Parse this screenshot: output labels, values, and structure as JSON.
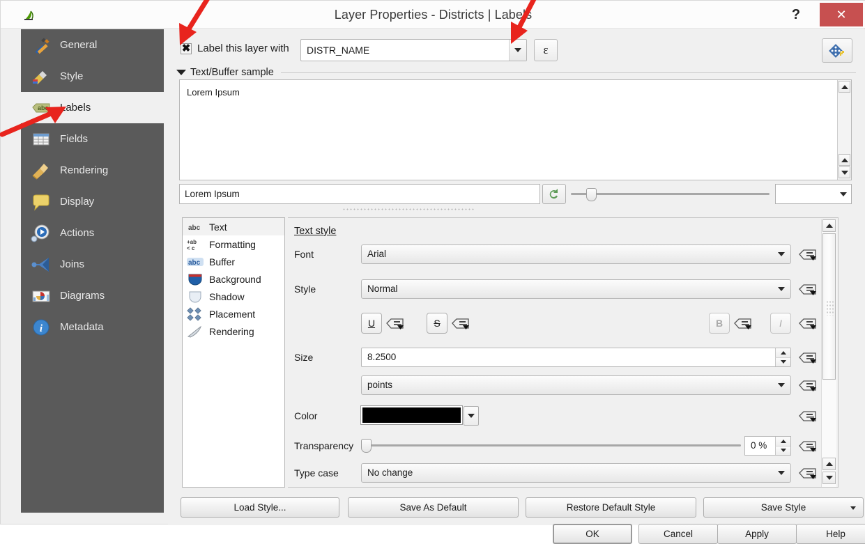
{
  "window": {
    "title": "Layer Properties - Districts | Labels",
    "app_icon": "qgis-icon",
    "help_label": "?",
    "close_label": "✕"
  },
  "sidebar": {
    "items": [
      {
        "label": "General",
        "icon": "tools-icon",
        "selected": false
      },
      {
        "label": "Style",
        "icon": "brush-icon",
        "selected": false
      },
      {
        "label": "Labels",
        "icon": "abc-label-icon",
        "selected": true
      },
      {
        "label": "Fields",
        "icon": "table-icon",
        "selected": false
      },
      {
        "label": "Rendering",
        "icon": "broom-icon",
        "selected": false
      },
      {
        "label": "Display",
        "icon": "callout-icon",
        "selected": false
      },
      {
        "label": "Actions",
        "icon": "gear-play-icon",
        "selected": false
      },
      {
        "label": "Joins",
        "icon": "join-icon",
        "selected": false
      },
      {
        "label": "Diagrams",
        "icon": "chart-icon",
        "selected": false
      },
      {
        "label": "Metadata",
        "icon": "info-icon",
        "selected": false
      }
    ]
  },
  "label_row": {
    "checkbox_glyph": "✖",
    "checkbox_checked": true,
    "label": "Label this layer with",
    "field_value": "DISTR_NAME",
    "expression_button": "ε",
    "auto_placement_icon": "auto-placement-icon"
  },
  "sample_group": {
    "title": "Text/Buffer sample",
    "collapsed": false,
    "preview_text": "Lorem Ipsum",
    "input_value": "Lorem Ipsum",
    "revert_icon": "revert-arrow-icon",
    "zoom_value": ""
  },
  "subtabs": {
    "items": [
      {
        "label": "Text",
        "icon": "abc-text-icon",
        "selected": true
      },
      {
        "label": "Formatting",
        "icon": "formatting-icon",
        "selected": false
      },
      {
        "label": "Buffer",
        "icon": "abc-buffer-icon",
        "selected": false
      },
      {
        "label": "Background",
        "icon": "background-icon",
        "selected": false
      },
      {
        "label": "Shadow",
        "icon": "shadow-icon",
        "selected": false
      },
      {
        "label": "Placement",
        "icon": "placement-icon",
        "selected": false
      },
      {
        "label": "Rendering",
        "icon": "rendering-brush-icon",
        "selected": false
      }
    ]
  },
  "text_style": {
    "section_title": "Text style",
    "font_label": "Font",
    "font_value": "Arial",
    "style_label": "Style",
    "style_value": "Normal",
    "underline_button": "U",
    "strikeout_button": "S",
    "bold_button": "B",
    "italic_button": "I",
    "size_label": "Size",
    "size_value": "8.2500",
    "size_unit_value": "points",
    "color_label": "Color",
    "color_value": "#000000",
    "transparency_label": "Transparency",
    "transparency_value": "0 %",
    "typecase_label": "Type case",
    "typecase_value": "No change"
  },
  "footer": {
    "load_style": "Load Style...",
    "save_as_default": "Save As Default",
    "restore_default_style": "Restore Default Style",
    "save_style": "Save Style",
    "ok": "OK",
    "cancel": "Cancel",
    "apply": "Apply",
    "help": "Help"
  },
  "annotations": {
    "color": "#e8241d",
    "arrows": [
      {
        "name": "arrow-to-checkbox"
      },
      {
        "name": "arrow-to-field-dropdown"
      },
      {
        "name": "arrow-to-labels-tab"
      }
    ]
  }
}
